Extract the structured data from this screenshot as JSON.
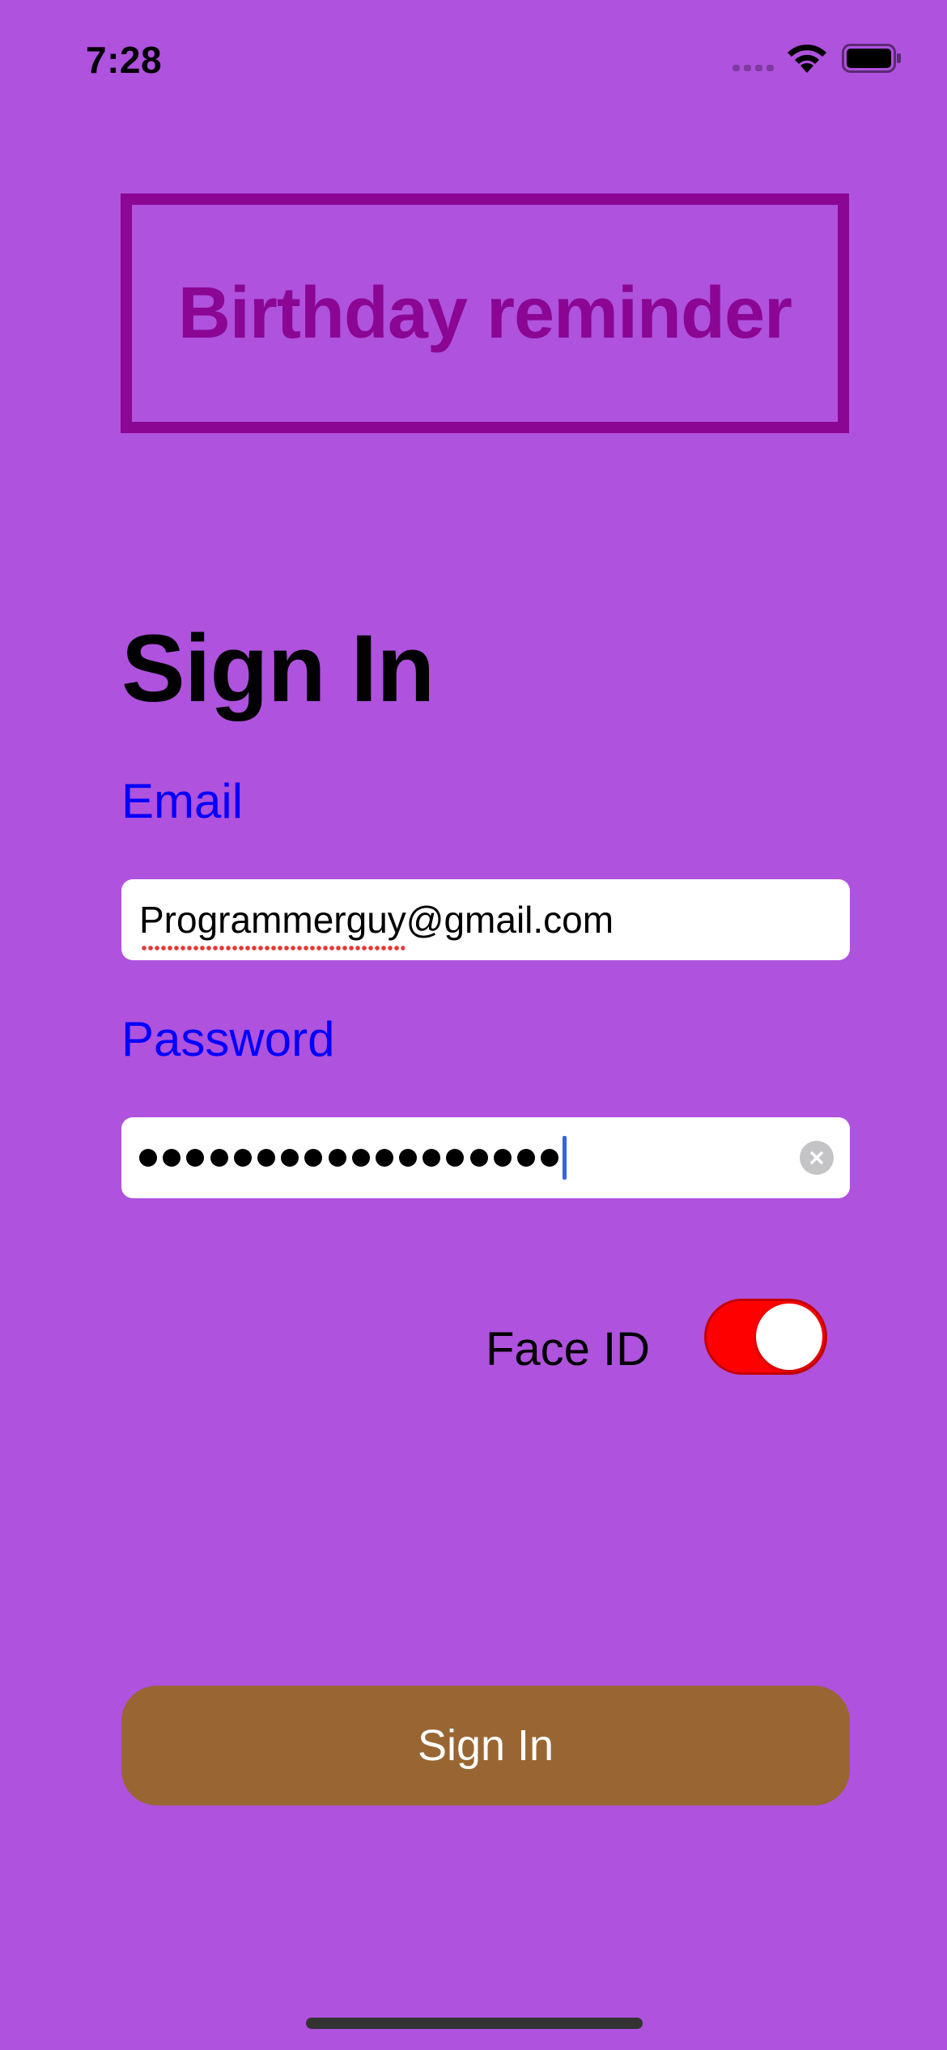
{
  "status_bar": {
    "time": "7:28"
  },
  "app": {
    "title": "Birthday reminder"
  },
  "form": {
    "heading": "Sign In",
    "email_label": "Email",
    "email_value": "Programmerguy@gmail.com",
    "password_label": "Password",
    "password_masked_length": 18,
    "face_id_label": "Face ID",
    "face_id_enabled": true,
    "submit_label": "Sign In"
  },
  "colors": {
    "background": "#af52de",
    "title_accent": "#8a0693",
    "field_label": "#0000ff",
    "toggle_on": "#ff0000",
    "button_fill": "#996633"
  },
  "icons": [
    "signal-icon",
    "wifi-icon",
    "battery-icon",
    "clear-icon"
  ]
}
